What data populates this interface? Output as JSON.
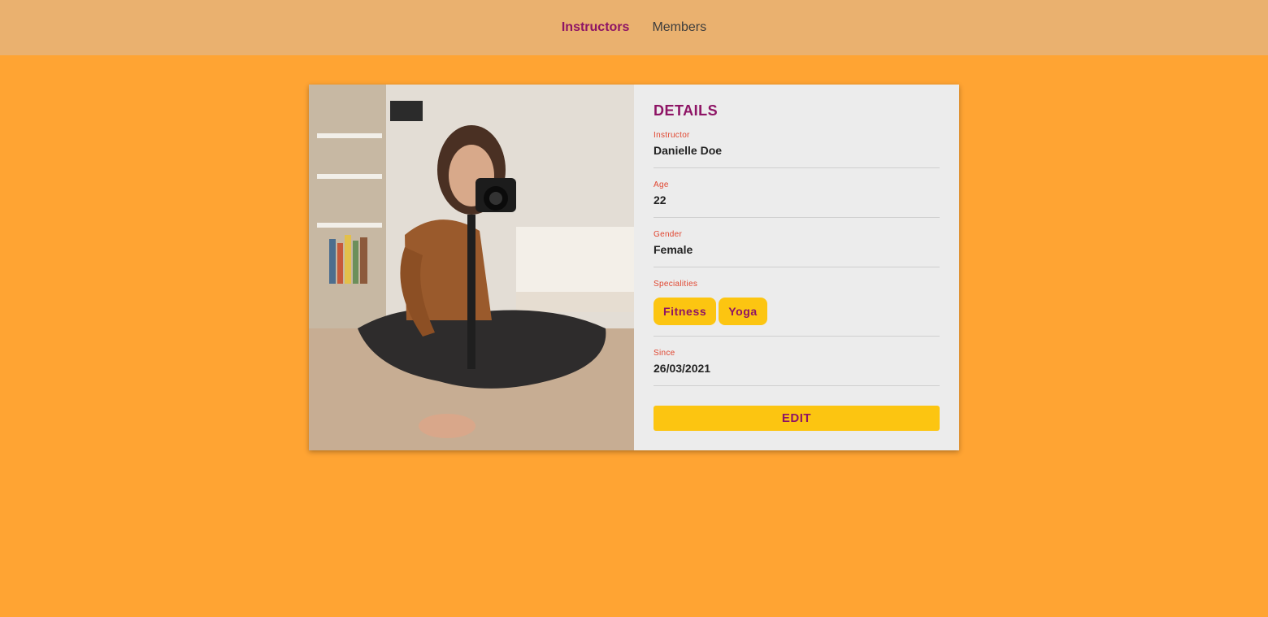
{
  "nav": {
    "items": [
      {
        "label": "Instructors",
        "active": true
      },
      {
        "label": "Members",
        "active": false
      }
    ]
  },
  "colors": {
    "page_background": "#ffa433",
    "topbar_background": "#eab16f",
    "card_background": "#ececec",
    "accent": "#8e1465",
    "label": "#e0452f",
    "chip_background": "#fcc511"
  },
  "card": {
    "photo": {
      "icon": "instructor-photo"
    },
    "details": {
      "title": "DETAILS",
      "fields": [
        {
          "label": "Instructor",
          "value": "Danielle Doe"
        },
        {
          "label": "Age",
          "value": "22"
        },
        {
          "label": "Gender",
          "value": "Female"
        },
        {
          "label": "Specialities",
          "chips": [
            "Fitness",
            "Yoga"
          ]
        },
        {
          "label": "Since",
          "value": "26/03/2021"
        }
      ],
      "edit_label": "EDIT"
    }
  }
}
